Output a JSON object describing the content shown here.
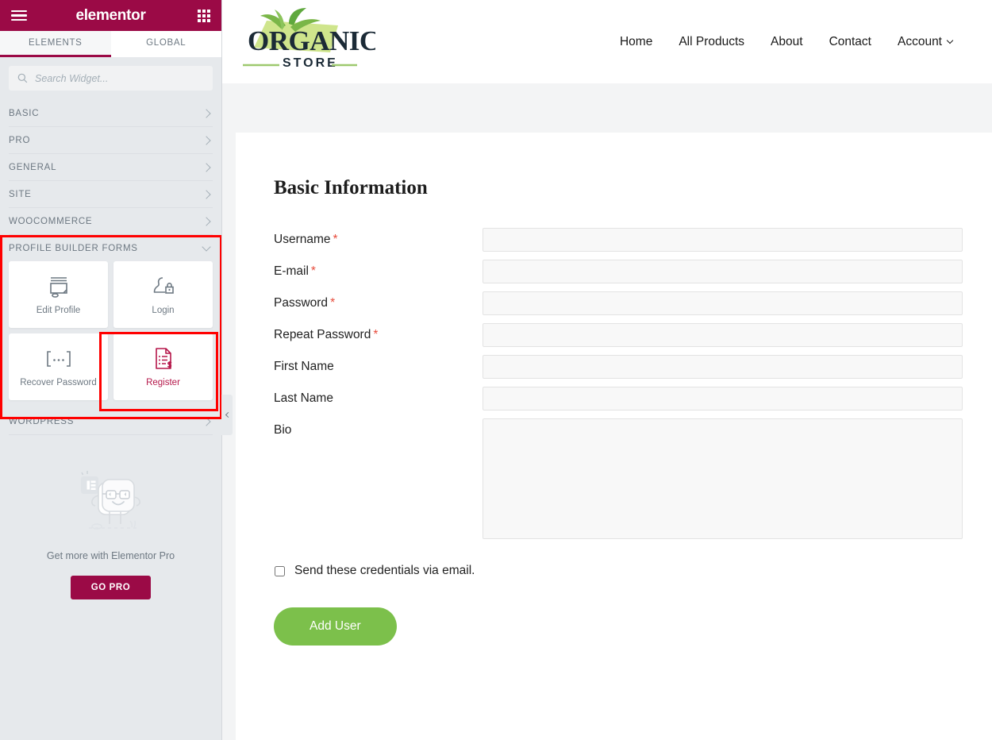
{
  "editor": {
    "brand": "elementor",
    "menu_icon": "hamburger-icon",
    "apps_icon": "grid-apps-icon",
    "tabs": [
      {
        "label": "ELEMENTS",
        "active": true
      },
      {
        "label": "GLOBAL",
        "active": false
      }
    ],
    "search": {
      "placeholder": "Search Widget...",
      "value": "",
      "icon": "search-icon"
    },
    "categories": [
      {
        "label": "BASIC",
        "expanded": false
      },
      {
        "label": "PRO",
        "expanded": false
      },
      {
        "label": "GENERAL",
        "expanded": false
      },
      {
        "label": "SITE",
        "expanded": false
      },
      {
        "label": "WOOCOMMERCE",
        "expanded": false
      },
      {
        "label": "PROFILE BUILDER FORMS",
        "expanded": true
      },
      {
        "label": "WORDPRESS",
        "expanded": false
      }
    ],
    "widgets": [
      {
        "label": "Edit Profile",
        "icon": "monitor-edit-icon",
        "selected": false
      },
      {
        "label": "Login",
        "icon": "user-lock-icon",
        "selected": false
      },
      {
        "label": "Recover Password",
        "icon": "ellipsis-brackets-icon",
        "selected": false
      },
      {
        "label": "Register",
        "icon": "form-document-dollar-icon",
        "selected": true
      }
    ],
    "promo": {
      "mascot_icon": "elementor-mascot-icon",
      "text": "Get more with Elementor Pro",
      "button": "GO PRO"
    },
    "collapse_handle": {
      "icon": "chevron-left-icon"
    },
    "colors": {
      "brand": "#9b0a46",
      "panel_bg": "#e6e9ec",
      "highlight": "#ff0000",
      "selected_label": "#b5174a"
    }
  },
  "site": {
    "logo": {
      "primary": "ORGANIC",
      "secondary": "STORE",
      "icon": "organic-leaf-logo"
    },
    "nav": [
      {
        "label": "Home",
        "has_dropdown": false
      },
      {
        "label": "All Products",
        "has_dropdown": false
      },
      {
        "label": "About",
        "has_dropdown": false
      },
      {
        "label": "Contact",
        "has_dropdown": false
      },
      {
        "label": "Account",
        "has_dropdown": true
      }
    ]
  },
  "form": {
    "title": "Basic Information",
    "fields": [
      {
        "label": "Username",
        "required": true,
        "type": "text",
        "value": ""
      },
      {
        "label": "E-mail",
        "required": true,
        "type": "text",
        "value": ""
      },
      {
        "label": "Password",
        "required": true,
        "type": "text",
        "value": ""
      },
      {
        "label": "Repeat Password",
        "required": true,
        "type": "text",
        "value": ""
      },
      {
        "label": "First Name",
        "required": false,
        "type": "text",
        "value": ""
      },
      {
        "label": "Last Name",
        "required": false,
        "type": "text",
        "value": ""
      },
      {
        "label": "Bio",
        "required": false,
        "type": "textarea",
        "value": ""
      }
    ],
    "checkbox": {
      "label": "Send these credentials via email.",
      "checked": false
    },
    "submit": {
      "label": "Add User",
      "color": "#7cc04b"
    }
  }
}
